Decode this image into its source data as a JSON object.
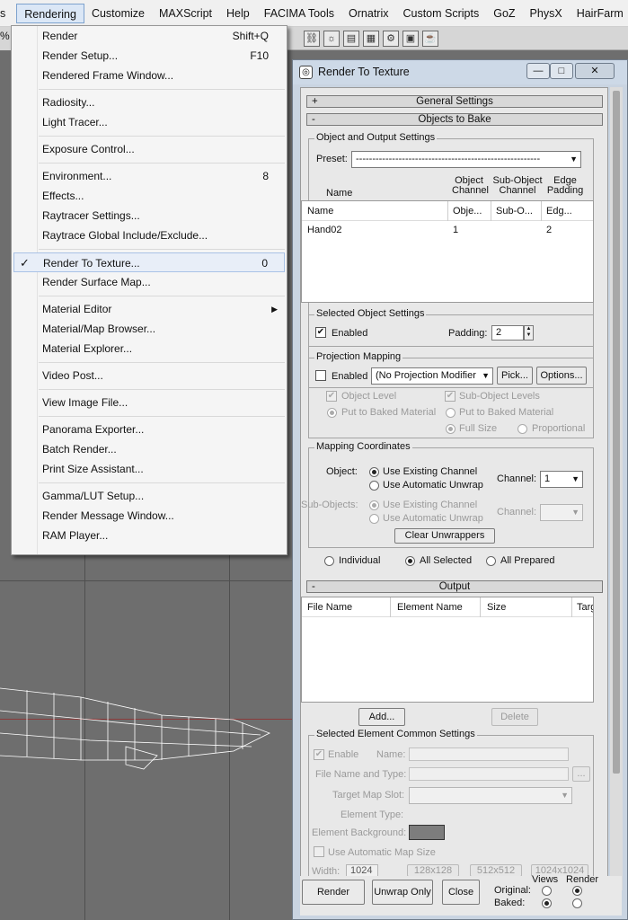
{
  "menubar": {
    "items": [
      {
        "label": "s",
        "active": false
      },
      {
        "label": "Rendering",
        "active": true
      },
      {
        "label": "Customize",
        "active": false
      },
      {
        "label": "MAXScript",
        "active": false
      },
      {
        "label": "Help",
        "active": false
      },
      {
        "label": "FACIMA Tools",
        "active": false
      },
      {
        "label": "Ornatrix",
        "active": false
      },
      {
        "label": "Custom Scripts",
        "active": false
      },
      {
        "label": "GoZ",
        "active": false
      },
      {
        "label": "PhysX",
        "active": false
      },
      {
        "label": "HairFarm",
        "active": false
      }
    ],
    "left_fragment": "%"
  },
  "rendering_menu": {
    "items": [
      {
        "label": "Render",
        "shortcut": "Shift+Q"
      },
      {
        "label": "Render Setup...",
        "shortcut": "F10"
      },
      {
        "label": "Rendered Frame Window...",
        "shortcut": ""
      },
      {
        "label": "Radiosity...",
        "shortcut": ""
      },
      {
        "label": "Light Tracer...",
        "shortcut": ""
      },
      {
        "label": "Exposure Control...",
        "shortcut": ""
      },
      {
        "label": "Environment...",
        "shortcut": "8"
      },
      {
        "label": "Effects...",
        "shortcut": ""
      },
      {
        "label": "Raytracer Settings...",
        "shortcut": ""
      },
      {
        "label": "Raytrace Global Include/Exclude...",
        "shortcut": ""
      },
      {
        "label": "Render To Texture...",
        "shortcut": "0",
        "checked": true,
        "highlighted": true
      },
      {
        "label": "Render Surface Map...",
        "shortcut": ""
      },
      {
        "label": "Material Editor",
        "shortcut": "",
        "submenu": true
      },
      {
        "label": "Material/Map Browser...",
        "shortcut": ""
      },
      {
        "label": "Material Explorer...",
        "shortcut": ""
      },
      {
        "label": "Video Post...",
        "shortcut": ""
      },
      {
        "label": "View Image File...",
        "shortcut": ""
      },
      {
        "label": "Panorama Exporter...",
        "shortcut": ""
      },
      {
        "label": "Batch Render...",
        "shortcut": ""
      },
      {
        "label": "Print Size Assistant...",
        "shortcut": ""
      },
      {
        "label": "Gamma/LUT Setup...",
        "shortcut": ""
      },
      {
        "label": "Render Message Window...",
        "shortcut": ""
      },
      {
        "label": "RAM Player...",
        "shortcut": ""
      }
    ],
    "check_glyph": "✓",
    "submenu_glyph": "▶"
  },
  "dialog": {
    "title": "Render To Texture",
    "window_buttons": {
      "minimize": "—",
      "maximize": "□",
      "close": "✕"
    },
    "general_settings": {
      "toggle": "+",
      "label": "General Settings"
    },
    "objects_to_bake": {
      "toggle": "-",
      "label": "Objects to Bake",
      "object_output_settings": {
        "title": "Object and Output Settings",
        "preset_label": "Preset:",
        "preset_value": "--------------------------------------------------------"
      },
      "table": {
        "headers": {
          "name": "Name",
          "object_channel": "Object Channel",
          "sub_object_channel": "Sub-Object Channel",
          "edge_padding": "Edge Padding"
        },
        "columns": [
          "Name",
          "Obje...",
          "Sub-O...",
          "Edg..."
        ],
        "rows": [
          [
            "Hand02",
            "1",
            "",
            "2"
          ]
        ]
      },
      "selected_object_settings": {
        "title": "Selected Object Settings",
        "enabled_label": "Enabled",
        "enabled": true,
        "padding_label": "Padding:",
        "padding_value": "2"
      },
      "projection_mapping": {
        "title": "Projection Mapping",
        "enabled_label": "Enabled",
        "enabled": false,
        "modifier_value": "(No Projection Modifier",
        "pick_label": "Pick...",
        "options_label": "Options...",
        "object_level_label": "Object Level",
        "sub_object_levels_label": "Sub-Object Levels",
        "put_baked_1": "Put to Baked Material",
        "put_baked_2": "Put to Baked Material",
        "full_size_label": "Full Size",
        "proportional_label": "Proportional"
      },
      "mapping_coordinates": {
        "title": "Mapping Coordinates",
        "object_label": "Object:",
        "use_existing": "Use Existing Channel",
        "use_automatic": "Use Automatic Unwrap",
        "channel_label": "Channel:",
        "channel_value": "1",
        "sub_objects_label": "Sub-Objects:",
        "sub_use_existing": "Use Existing Channel",
        "sub_use_automatic": "Use Automatic Unwrap",
        "sub_channel_label": "Channel:",
        "clear_unwrappers": "Clear Unwrappers"
      },
      "scope": {
        "individual": "Individual",
        "all_selected": "All Selected",
        "all_prepared": "All Prepared"
      }
    },
    "output": {
      "toggle": "-",
      "label": "Output",
      "columns": [
        "File Name",
        "Element Name",
        "Size",
        "Targ"
      ],
      "add_label": "Add...",
      "delete_label": "Delete",
      "selected_element": {
        "title": "Selected Element Common Settings",
        "enable_label": "Enable",
        "name_label": "Name:",
        "file_name_type_label": "File Name and Type:",
        "browse_label": "...",
        "target_map_slot_label": "Target Map Slot:",
        "element_type_label": "Element Type:",
        "element_background_label": "Element Background:",
        "use_auto_map_size": "Use Automatic Map Size",
        "width_label": "Width:",
        "width_value": "1024",
        "size_presets": [
          "128x128",
          "512x512",
          "1024x1024"
        ]
      }
    },
    "footer": {
      "render": "Render",
      "unwrap_only": "Unwrap Only",
      "close": "Close",
      "views_label": "Views",
      "render_label": "Render",
      "original_label": "Original:",
      "baked_label": "Baked:"
    }
  },
  "colors": {
    "viewport": "#6e6e6e",
    "dialog_frame": "#c9d4e1",
    "highlight": "#e8eef8"
  }
}
